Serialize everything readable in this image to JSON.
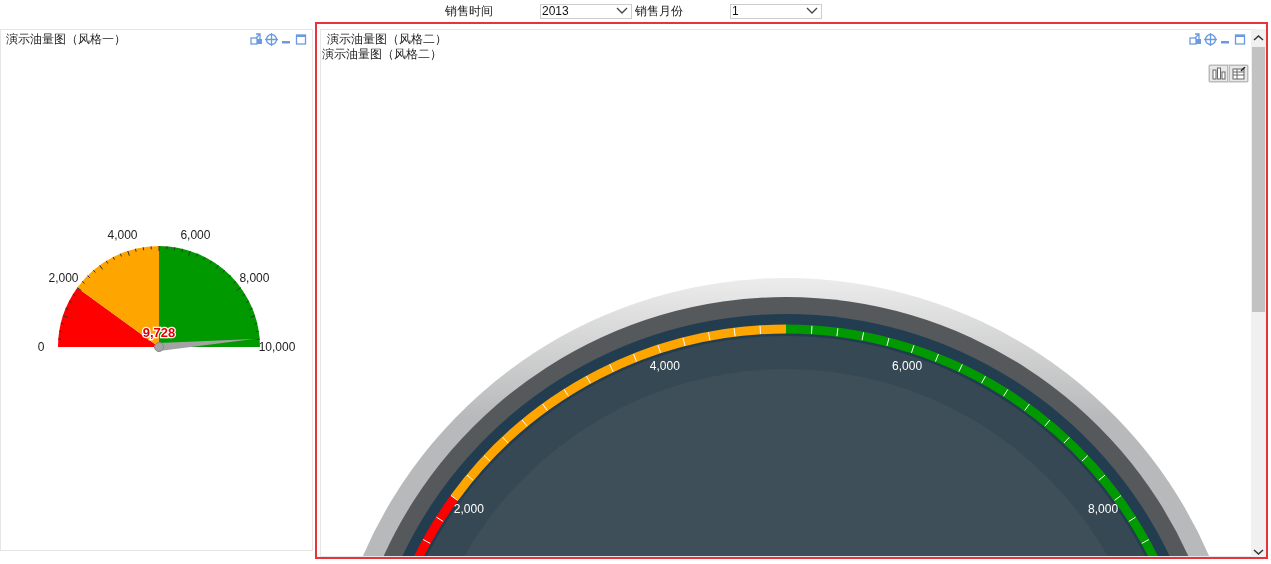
{
  "filters": [
    {
      "label": "销售时间",
      "value": "2013"
    },
    {
      "label": "销售月份",
      "value": "1"
    }
  ],
  "panels": [
    {
      "kind": "basic",
      "selected": false,
      "title": "演示油量图（风格一）",
      "gauge": {
        "ticks": [
          {
            "label": "0"
          },
          {
            "label": "2,000"
          },
          {
            "label": "4,000"
          },
          {
            "label": "6,000"
          },
          {
            "label": "8,000"
          },
          {
            "label": "10,000"
          }
        ],
        "zones": [
          {
            "color": "#ff0000"
          },
          {
            "color": "#ffa500"
          },
          {
            "color": "#009900"
          }
        ],
        "value": "9,728",
        "needle": {
          "level": 0.9728
        }
      }
    },
    {
      "kind": "dark",
      "selected": true,
      "title": "演示油量图（风格二）",
      "subtitle": "演示油量图（风格二）",
      "gauge": {
        "ticks": [
          {
            "label": "2,000"
          },
          {
            "label": "4,000"
          },
          {
            "label": "6,000"
          },
          {
            "label": "8,000"
          }
        ],
        "zones": [
          {
            "color": "#ff0000"
          },
          {
            "color": "#ffa500"
          },
          {
            "color": "#009900"
          }
        ]
      }
    }
  ]
}
